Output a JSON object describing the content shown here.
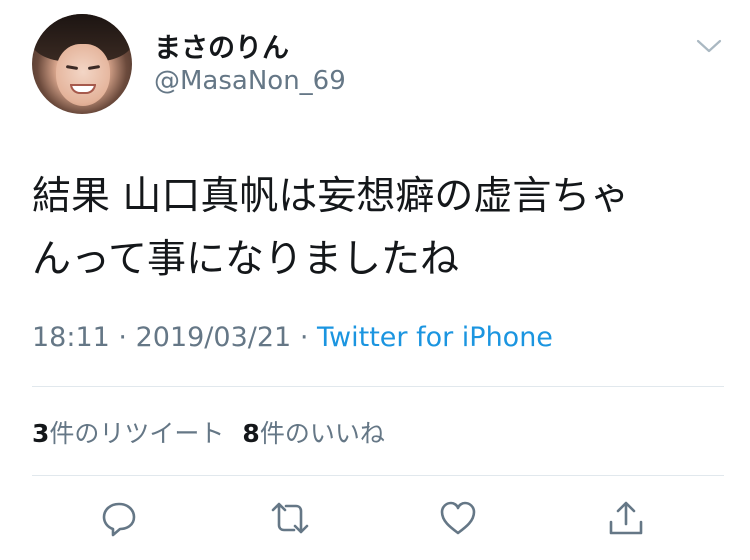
{
  "user": {
    "display_name": "まさのりん",
    "handle": "@MasaNon_69"
  },
  "tweet": {
    "text_line1": "結果 山口真帆は妄想癖の虚言ちゃ",
    "text_line2": "んって事になりましたね",
    "time": "18:11",
    "date": "2019/03/21",
    "separator": "·",
    "source": "Twitter for iPhone"
  },
  "stats": {
    "retweet_count": "3",
    "retweet_label": "件のリツイート",
    "like_count": "8",
    "like_label": "件のいいね"
  },
  "icons": {
    "menu": "chevron-down-icon",
    "reply": "reply-icon",
    "retweet": "retweet-icon",
    "like": "heart-icon",
    "share": "share-icon"
  },
  "colors": {
    "link": "#1b95e0",
    "secondary_text": "#657786",
    "primary_text": "#14171a",
    "icon": "#657786"
  }
}
